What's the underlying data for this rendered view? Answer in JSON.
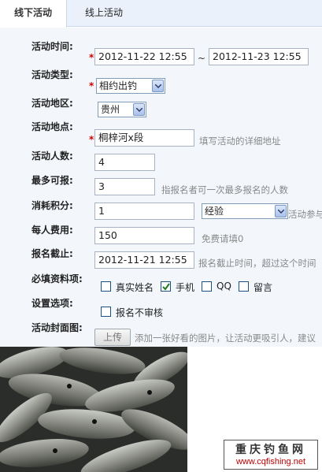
{
  "tabs": [
    {
      "label": "线下活动",
      "active": true
    },
    {
      "label": "线上活动",
      "active": false
    }
  ],
  "form": {
    "time": {
      "label": "活动时间:",
      "start": "2012-11-22 12:55",
      "separator": "~",
      "end": "2012-11-23 12:55"
    },
    "type": {
      "label": "活动类型:",
      "selected": "相约出钓"
    },
    "region": {
      "label": "活动地区:",
      "selected": "贵州"
    },
    "place": {
      "label": "活动地点:",
      "value": "桐梓河x段",
      "hint": "填写活动的详细地址"
    },
    "participants": {
      "label": "活动人数:",
      "value": "4"
    },
    "max_signup": {
      "label": "最多可报:",
      "value": "3",
      "hint": "指报名者可一次最多报名的人数"
    },
    "points": {
      "label": "消耗积分:",
      "value": "1",
      "unit_selected": "经验",
      "hint": "活动参与"
    },
    "fee": {
      "label": "每人费用:",
      "value": "150",
      "hint": "免费请填0"
    },
    "deadline": {
      "label": "报名截止:",
      "value": "2012-11-21 12:55",
      "hint": "报名截止时间，超过这个时间"
    },
    "required_info": {
      "label": "必填资料项:",
      "options": [
        {
          "label": "真实姓名",
          "checked": false
        },
        {
          "label": "手机",
          "checked": true
        },
        {
          "label": "QQ",
          "checked": false
        },
        {
          "label": "留言",
          "checked": false
        }
      ]
    },
    "settings": {
      "label": "设置选项:",
      "options": [
        {
          "label": "报名不审核",
          "checked": false
        }
      ]
    },
    "cover": {
      "label": "活动封面图:",
      "upload_button": "上传",
      "hint": "添加一张好看的图片，让活动更吸引人，建议"
    }
  },
  "watermark": {
    "title": "重庆钓鱼网",
    "url": "www.cqfishing.net"
  },
  "colors": {
    "required": "#d00000",
    "form_bg": "#f3f7fc",
    "tab_bar_bg": "#eaf1fa",
    "hint": "#888888",
    "checkmark": "#1f7a1f",
    "watermark_url": "#c00000"
  }
}
